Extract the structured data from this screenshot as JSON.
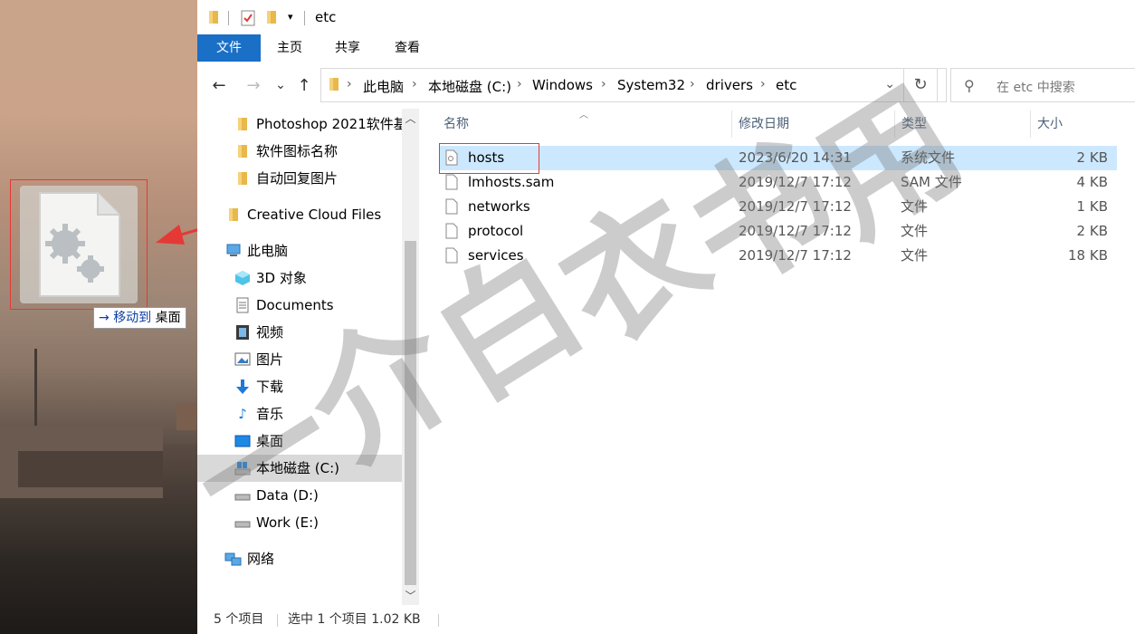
{
  "desktop": {
    "drag_tooltip": {
      "arrow": "→",
      "action": "移动到",
      "target": "桌面"
    }
  },
  "window": {
    "title": "etc",
    "ribbon_tabs": [
      "文件",
      "主页",
      "共享",
      "查看"
    ],
    "nav_buttons": {
      "back": "←",
      "forward": "→",
      "recent": "⌄",
      "up": "↑"
    },
    "address": {
      "crumbs": [
        "此电脑",
        "本地磁盘 (C:)",
        "Windows",
        "System32",
        "drivers",
        "etc"
      ],
      "separator": "›",
      "dropdown": "⌄",
      "refresh": "↻"
    },
    "search": {
      "placeholder": "在 etc 中搜索"
    }
  },
  "navigation": {
    "items": [
      {
        "label": "Photoshop 2021软件基",
        "icon": "folder-icon"
      },
      {
        "label": "软件图标名称",
        "icon": "folder-icon"
      },
      {
        "label": "自动回复图片",
        "icon": "folder-icon"
      },
      {
        "label": "Creative Cloud Files",
        "icon": "folder-icon"
      },
      {
        "label": "此电脑",
        "icon": "computer-icon"
      },
      {
        "label": "3D 对象",
        "icon": "cube-icon"
      },
      {
        "label": "Documents",
        "icon": "document-icon"
      },
      {
        "label": "视频",
        "icon": "video-icon"
      },
      {
        "label": "图片",
        "icon": "picture-icon"
      },
      {
        "label": "下载",
        "icon": "download-icon"
      },
      {
        "label": "音乐",
        "icon": "music-icon"
      },
      {
        "label": "桌面",
        "icon": "desktop-icon"
      },
      {
        "label": "本地磁盘 (C:)",
        "icon": "drive-c-icon",
        "selected": true
      },
      {
        "label": "Data (D:)",
        "icon": "drive-icon"
      },
      {
        "label": "Work (E:)",
        "icon": "drive-icon"
      },
      {
        "label": "网络",
        "icon": "network-icon"
      }
    ]
  },
  "file_list": {
    "columns": [
      "名称",
      "修改日期",
      "类型",
      "大小"
    ],
    "rows": [
      {
        "name": "hosts",
        "date": "2023/6/20 14:31",
        "type": "系统文件",
        "size": "2 KB",
        "selected": true
      },
      {
        "name": "lmhosts.sam",
        "date": "2019/12/7 17:12",
        "type": "SAM 文件",
        "size": "4 KB"
      },
      {
        "name": "networks",
        "date": "2019/12/7 17:12",
        "type": "文件",
        "size": "1 KB"
      },
      {
        "name": "protocol",
        "date": "2019/12/7 17:12",
        "type": "文件",
        "size": "2 KB"
      },
      {
        "name": "services",
        "date": "2019/12/7 17:12",
        "type": "文件",
        "size": "18 KB"
      }
    ]
  },
  "status_bar": {
    "item_count": "5 个项目",
    "selection": "选中 1 个项目  1.02 KB"
  },
  "watermark": {
    "chars": [
      "一",
      "介",
      "白",
      "衣",
      "书",
      "用"
    ]
  },
  "colors": {
    "accent": "#1a6fc6",
    "selection": "#cce8ff",
    "highlight_box": "#e53935"
  }
}
